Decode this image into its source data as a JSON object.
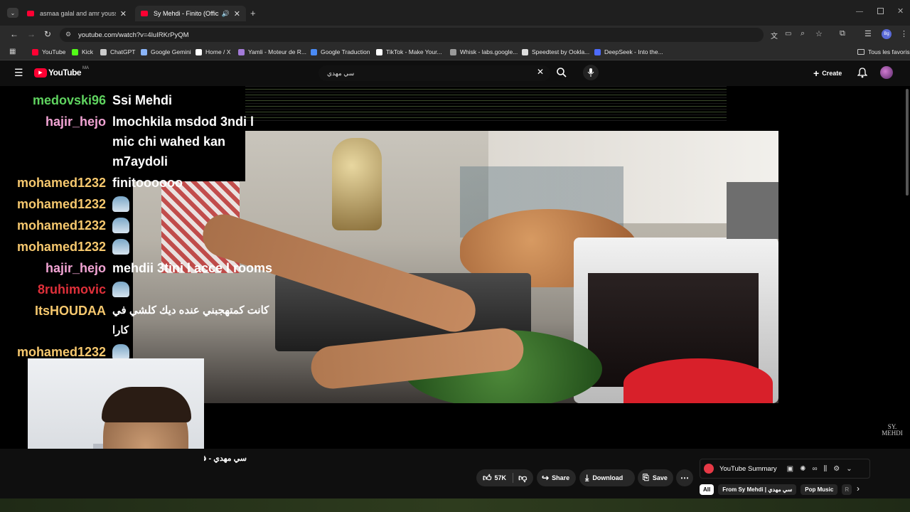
{
  "tabs": [
    {
      "title": "asmaa galal and amr youssef -",
      "active": false
    },
    {
      "title": "Sy Mehdi - Finito (Official M",
      "active": true
    }
  ],
  "address": "youtube.com/watch?v=4luIRKrPyQM",
  "bookmarks": [
    {
      "label": "YouTube",
      "icon": "youtube-icon",
      "color": "#ff0033"
    },
    {
      "label": "Kick",
      "icon": "kick-icon",
      "color": "#53fc18"
    },
    {
      "label": "ChatGPT",
      "icon": "chatgpt-icon",
      "color": "#cccccc"
    },
    {
      "label": "Google Gemini",
      "icon": "gemini-icon",
      "color": "#8ab4f8"
    },
    {
      "label": "Home / X",
      "icon": "x-icon",
      "color": "#ffffff"
    },
    {
      "label": "Yamli - Moteur de R...",
      "icon": "yamli-icon",
      "color": "#a37bd8"
    },
    {
      "label": "Google Traduction",
      "icon": "translate-icon",
      "color": "#4a8af4"
    },
    {
      "label": "TikTok - Make Your...",
      "icon": "tiktok-icon",
      "color": "#ffffff"
    },
    {
      "label": "Whisk - labs.google...",
      "icon": "whisk-icon",
      "color": "#9a9a9a"
    },
    {
      "label": "Speedtest by Ookla...",
      "icon": "speedtest-icon",
      "color": "#dddddd"
    },
    {
      "label": "DeepSeek - Into the...",
      "icon": "deepseek-icon",
      "color": "#4d6bfe"
    }
  ],
  "bookmarks_right": "Tous les favoris",
  "youtube": {
    "logo": "YouTube",
    "region": "MA",
    "search_value": "سي مهدي",
    "create_label": "Create",
    "avatar_initials": "Bg"
  },
  "chat": [
    {
      "name": "medovski96",
      "color": "#5fd35f",
      "lines": [
        "Ssi Mehdi"
      ],
      "emoji": false
    },
    {
      "name": "hajir_hejo",
      "color": "#f2a4d4",
      "lines": [
        "lmochkila msdod 3ndi l",
        "mic chi wahed kan",
        "m7aydoli"
      ],
      "emoji": false
    },
    {
      "name": "mohamed1232",
      "color": "#f6c86e",
      "lines": [
        "finitoooooo"
      ],
      "emoji": false
    },
    {
      "name": "mohamed1232",
      "color": "#f6c86e",
      "lines": [],
      "emoji": true
    },
    {
      "name": "mohamed1232",
      "color": "#f6c86e",
      "lines": [],
      "emoji": true
    },
    {
      "name": "mohamed1232",
      "color": "#f6c86e",
      "lines": [],
      "emoji": true
    },
    {
      "name": "hajir_hejo",
      "color": "#f2a4d4",
      "lines": [
        "mehdii 3tini l acce l rooms"
      ],
      "emoji": false
    },
    {
      "name": "8ruhimovic",
      "color": "#e0303a",
      "lines": [],
      "emoji": true
    },
    {
      "name": "ItsHOUDAA",
      "color": "#f6c86e",
      "lines": [
        "كانت كمتهجبني عنده ديك كلشي في",
        "كارا"
      ],
      "emoji": false
    },
    {
      "name": "mohamed1232",
      "color": "#f6c86e",
      "lines": [],
      "emoji": true
    }
  ],
  "video": {
    "watermark": "SY. MEHDI",
    "title_partial": "سي مهدي - فينيتو"
  },
  "actions": {
    "likes": "57K",
    "share": "Share",
    "download": "Download",
    "save": "Save"
  },
  "extension": {
    "label": "YouTube Summary"
  },
  "chips": [
    "All",
    "From Sy Mehdi | سي مهدي",
    "Pop Music",
    "R"
  ]
}
